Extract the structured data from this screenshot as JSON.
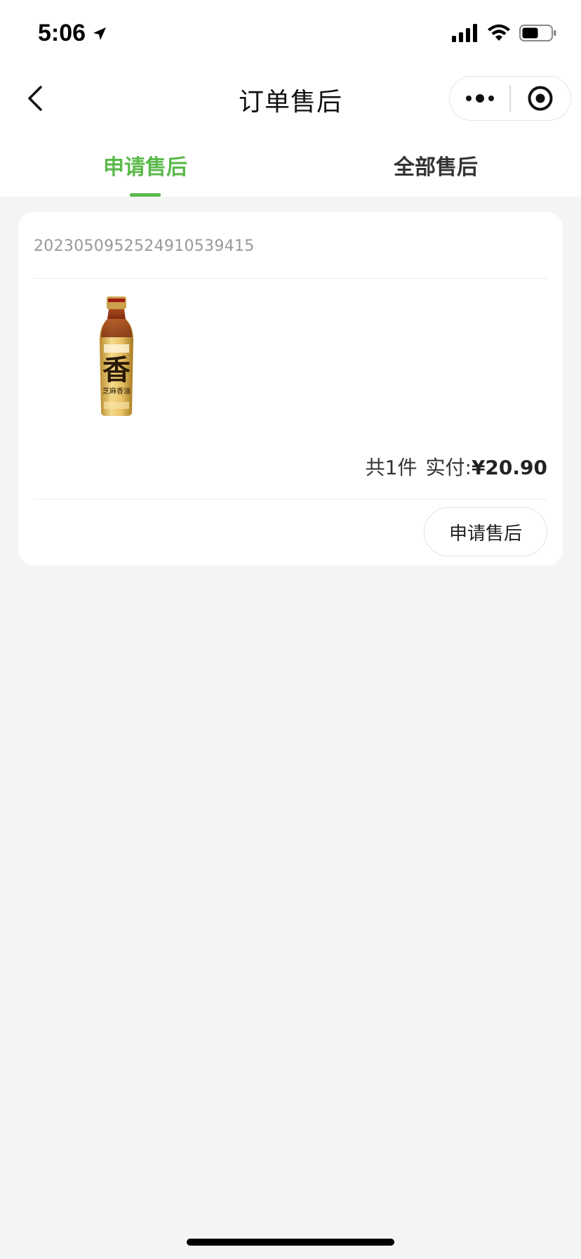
{
  "status_bar": {
    "time": "5:06"
  },
  "nav": {
    "title": "订单售后"
  },
  "tabs": [
    {
      "label": "申请售后",
      "active": true
    },
    {
      "label": "全部售后",
      "active": false
    }
  ],
  "order": {
    "order_no": "20230509525249105394‌15",
    "product_icon": "sesame-oil-bottle",
    "count_text": "共1件",
    "paid_label": "实付:",
    "paid_amount": "¥20.90",
    "action_label": "申请售后"
  },
  "colors": {
    "accent": "#5ab94a",
    "background": "#f4f4f4"
  }
}
